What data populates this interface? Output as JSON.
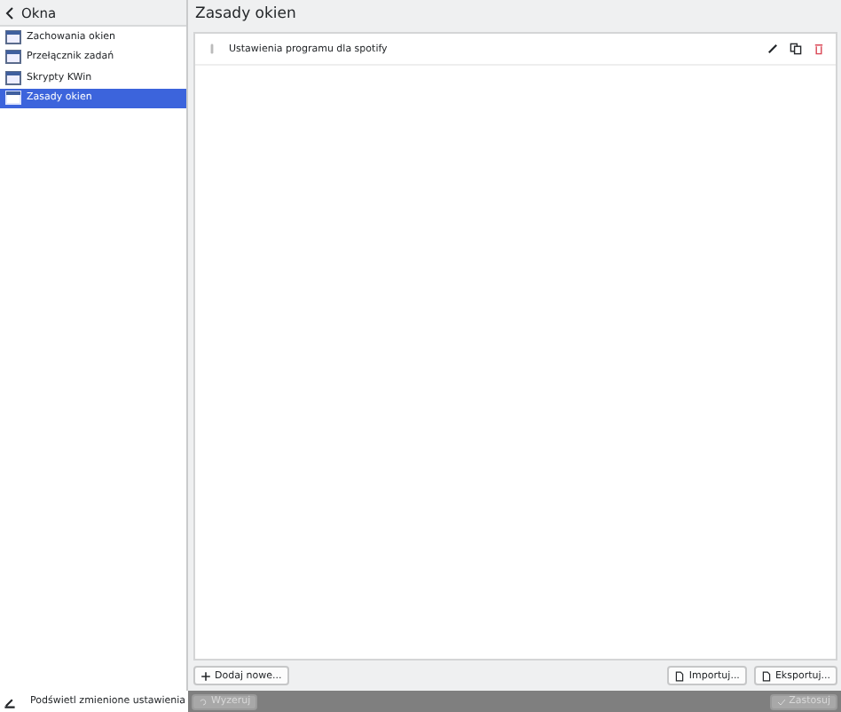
{
  "sidebar": {
    "title": "Okna",
    "items": [
      {
        "label": "Zachowania okien",
        "selected": false
      },
      {
        "label": "Przełącznik zadań",
        "selected": false
      },
      {
        "label": "Skrypty KWin",
        "selected": false
      },
      {
        "label": "Zasady okien",
        "selected": true
      }
    ],
    "footer_label": "Podświetl zmienione ustawienia"
  },
  "page": {
    "title": "Zasady okien",
    "rules": [
      {
        "name": "Ustawienia programu dla spotify"
      }
    ],
    "buttons": {
      "add": "Dodaj nowe...",
      "import": "Importuj...",
      "export": "Eksportuj..."
    }
  },
  "footer": {
    "reset": {
      "label": "Wyzeruj",
      "disabled": true
    },
    "apply": {
      "label": "Zastosuj",
      "disabled": true
    }
  }
}
